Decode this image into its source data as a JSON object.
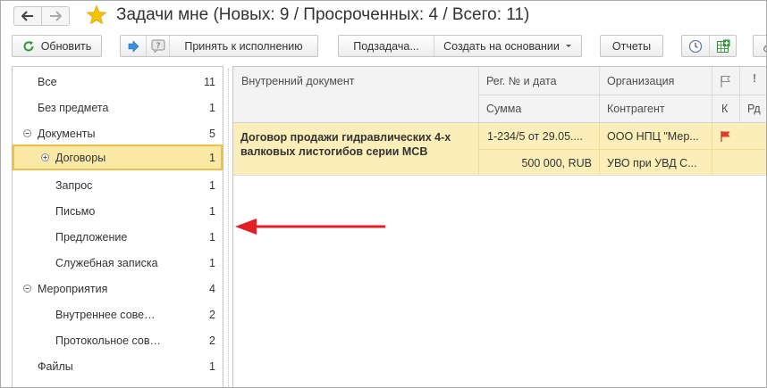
{
  "window": {
    "title": "Задачи мне (Новых: 9 / Просроченных: 4 / Всего: 11)"
  },
  "toolbar": {
    "refresh_label": "Обновить",
    "accept_label": "Принять к исполнению",
    "subtask_label": "Подзадача...",
    "create_based_label": "Создать на основании",
    "reports_label": "Отчеты"
  },
  "tree": {
    "items": [
      {
        "label": "Все",
        "count": "11"
      },
      {
        "label": "Без предмета",
        "count": "1"
      },
      {
        "label": "Документы",
        "count": "5"
      },
      {
        "label": "Договоры",
        "count": "1"
      },
      {
        "label": "Запрос",
        "count": "1"
      },
      {
        "label": "Письмо",
        "count": "1"
      },
      {
        "label": "Предложение",
        "count": "1"
      },
      {
        "label": "Служебная записка",
        "count": "1"
      },
      {
        "label": "Мероприятия",
        "count": "4"
      },
      {
        "label": "Внутреннее сове…",
        "count": "2"
      },
      {
        "label": "Протокольное сов…",
        "count": "2"
      },
      {
        "label": "Файлы",
        "count": "1"
      }
    ]
  },
  "grid": {
    "headers": {
      "doc": "Внутренний документ",
      "reg": "Рег. № и дата",
      "sum": "Сумма",
      "org": "Организация",
      "contr": "Контрагент",
      "k": "К",
      "rd": "Рд"
    },
    "rows": [
      {
        "doc_line1": "Договор продажи гидравлических 4-х",
        "doc_line2": "валковых листогибов серии МСВ",
        "reg": "1-234/5 от 29.05....",
        "sum": "500 000, RUB",
        "org": "ООО НПЦ \"Мер...",
        "contr": "УВО при УВД С..."
      }
    ]
  },
  "colors": {
    "selection_bg": "#fbe9a5",
    "row_bg": "#fbeeb8",
    "arrow": "#e31e24",
    "flag": "#e23a2f",
    "star": "#f5c400"
  }
}
